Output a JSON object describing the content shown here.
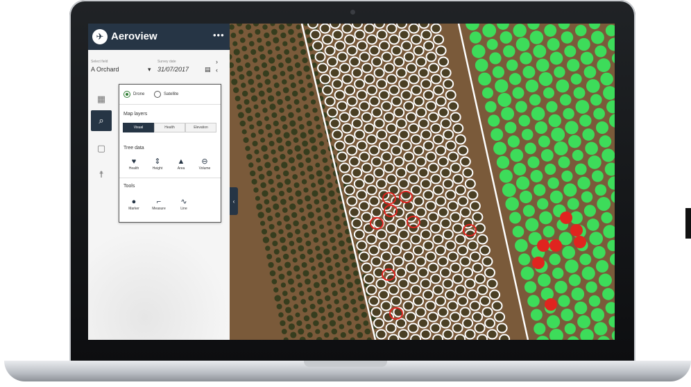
{
  "app": {
    "name": "Aeroview",
    "more_label": "•••",
    "logo_glyph": "✈"
  },
  "fields": {
    "field_label": "Select field",
    "field_value": "A Orchard",
    "date_label": "Survey date",
    "date_value": "31/07/2017",
    "dropdown_glyph": "▾",
    "calendar_glyph": "▤",
    "prev_glyph": "‹",
    "next_glyph": "›"
  },
  "nav": {
    "icons": [
      {
        "name": "dashboard-icon",
        "glyph": "▦"
      },
      {
        "name": "map-search-icon",
        "glyph": "⌕"
      },
      {
        "name": "layers-icon",
        "glyph": "▢"
      },
      {
        "name": "person-icon",
        "glyph": "☨"
      }
    ],
    "active_index": 1
  },
  "panel": {
    "source_options": [
      {
        "label": "Drone",
        "selected": true
      },
      {
        "label": "Satellite",
        "selected": false
      }
    ],
    "map_layers_title": "Map layers",
    "map_layers": [
      {
        "label": "Visual",
        "selected": true
      },
      {
        "label": "Health",
        "selected": false
      },
      {
        "label": "Elevation",
        "selected": false
      }
    ],
    "tree_data_title": "Tree data",
    "tree_data": [
      {
        "label": "Health",
        "glyph": "♥"
      },
      {
        "label": "Height",
        "glyph": "⇕"
      },
      {
        "label": "Area",
        "glyph": "▲"
      },
      {
        "label": "Volume",
        "glyph": "⊖"
      }
    ],
    "tools_title": "Tools",
    "tools": [
      {
        "label": "Marker",
        "glyph": "●"
      },
      {
        "label": "Measure",
        "glyph": "⌐"
      },
      {
        "label": "Line",
        "glyph": "∿"
      }
    ]
  },
  "collapse_glyph": "‹",
  "colors": {
    "nav_dark": "#263545",
    "accent_green": "#2e7d32",
    "health_good": "#3ddc5a",
    "health_bad": "#e0241f",
    "outline": "#ffffff",
    "soil": "#7a5a3a"
  }
}
